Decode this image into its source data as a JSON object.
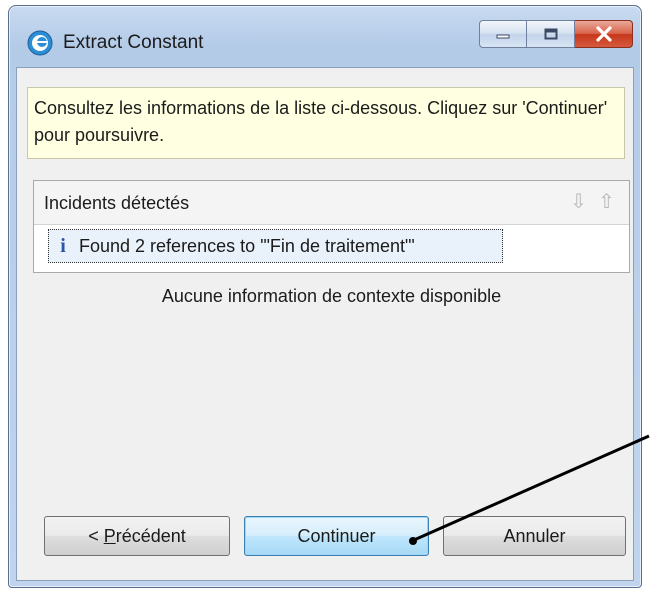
{
  "window": {
    "title": "Extract Constant",
    "icon": "eclipse-app-icon",
    "controls": [
      "minimize-icon",
      "maximize-icon",
      "close-icon"
    ]
  },
  "message": {
    "text": "Consultez les informations de la liste ci-dessous. Cliquez sur 'Continuer' pour poursuivre."
  },
  "issues": {
    "header": "Incidents détectés",
    "items": [
      {
        "icon": "info-icon",
        "text": "Found 2 references to '\"Fin de traitement\"'"
      }
    ]
  },
  "context": {
    "text": "Aucune information de contexte disponible"
  },
  "buttons": {
    "back_prefix": "< ",
    "back_mnemonic": "P",
    "back_rest": "récédent",
    "next": "Continuer",
    "cancel": "Annuler"
  },
  "colors": {
    "message_bg": "#ffffe1",
    "default_button_border": "#3c7fb1",
    "close_button": "#c7371b"
  }
}
